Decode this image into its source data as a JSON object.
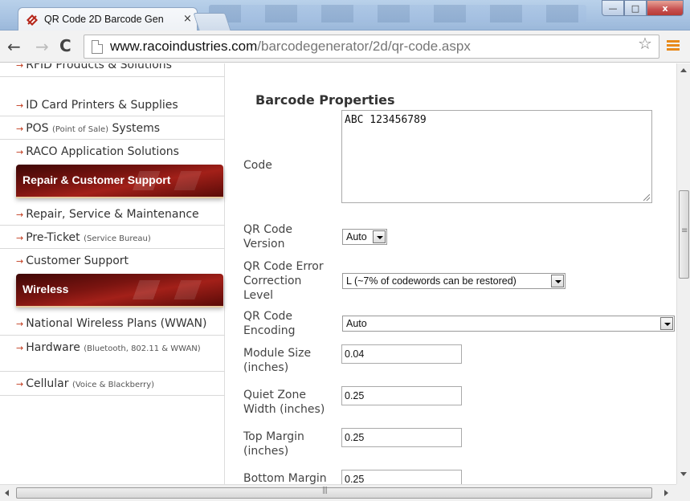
{
  "browser": {
    "tab_title": "QR Code 2D Barcode Gen",
    "tab_close": "×",
    "url_host": "www.racoindustries.com",
    "url_path": "/barcodegenerator/2d/qr-code.aspx",
    "window_buttons": {
      "minimize": "—",
      "maximize": "□",
      "close": "x"
    },
    "nav": {
      "back": "←",
      "forward": "→",
      "reload": "C",
      "star": "☆"
    }
  },
  "sidebar": {
    "top_items": [
      {
        "label": "RFID Products & Solutions",
        "note": ""
      },
      {
        "label": "ID Card Printers & Supplies",
        "note": ""
      },
      {
        "label": "POS",
        "note": "(Point of Sale)",
        "suffix": " Systems"
      },
      {
        "label": "RACO Application Solutions",
        "note": ""
      }
    ],
    "section1": "Repair & Customer Support",
    "repair_items": [
      {
        "label": "Repair, Service & Maintenance",
        "note": ""
      },
      {
        "label": "Pre-Ticket",
        "note": "(Service Bureau)"
      },
      {
        "label": "Customer Support",
        "note": ""
      }
    ],
    "section2": "Wireless",
    "wireless_items": [
      {
        "label": "National Wireless Plans (WWAN)",
        "note": ""
      },
      {
        "label": "Hardware",
        "note": "(Bluetooth, 802.11 & WWAN)"
      },
      {
        "label": "Cellular",
        "note": "(Voice & Blackberry)"
      }
    ],
    "arrow": "→"
  },
  "form": {
    "title": "Barcode Properties",
    "code_label": "Code",
    "code_value": "ABC 123456789",
    "version_label": "QR Code Version",
    "version_value": "Auto",
    "ecl_label": "QR Code Error Correction Level",
    "ecl_value": "L (~7% of codewords can be restored)",
    "encoding_label": "QR Code Encoding",
    "encoding_value": "Auto",
    "module_label": "Module Size (inches)",
    "module_value": "0.04",
    "quiet_label": "Quiet Zone Width (inches)",
    "quiet_value": "0.25",
    "top_label": "Top Margin (inches)",
    "top_value": "0.25",
    "bottom_label": "Bottom Margin",
    "bottom_value": "0.25"
  },
  "colors": {
    "accent_arrow": "#c0391b",
    "section_bg": "#7a1410",
    "menu_orange": "#e88a1a"
  }
}
